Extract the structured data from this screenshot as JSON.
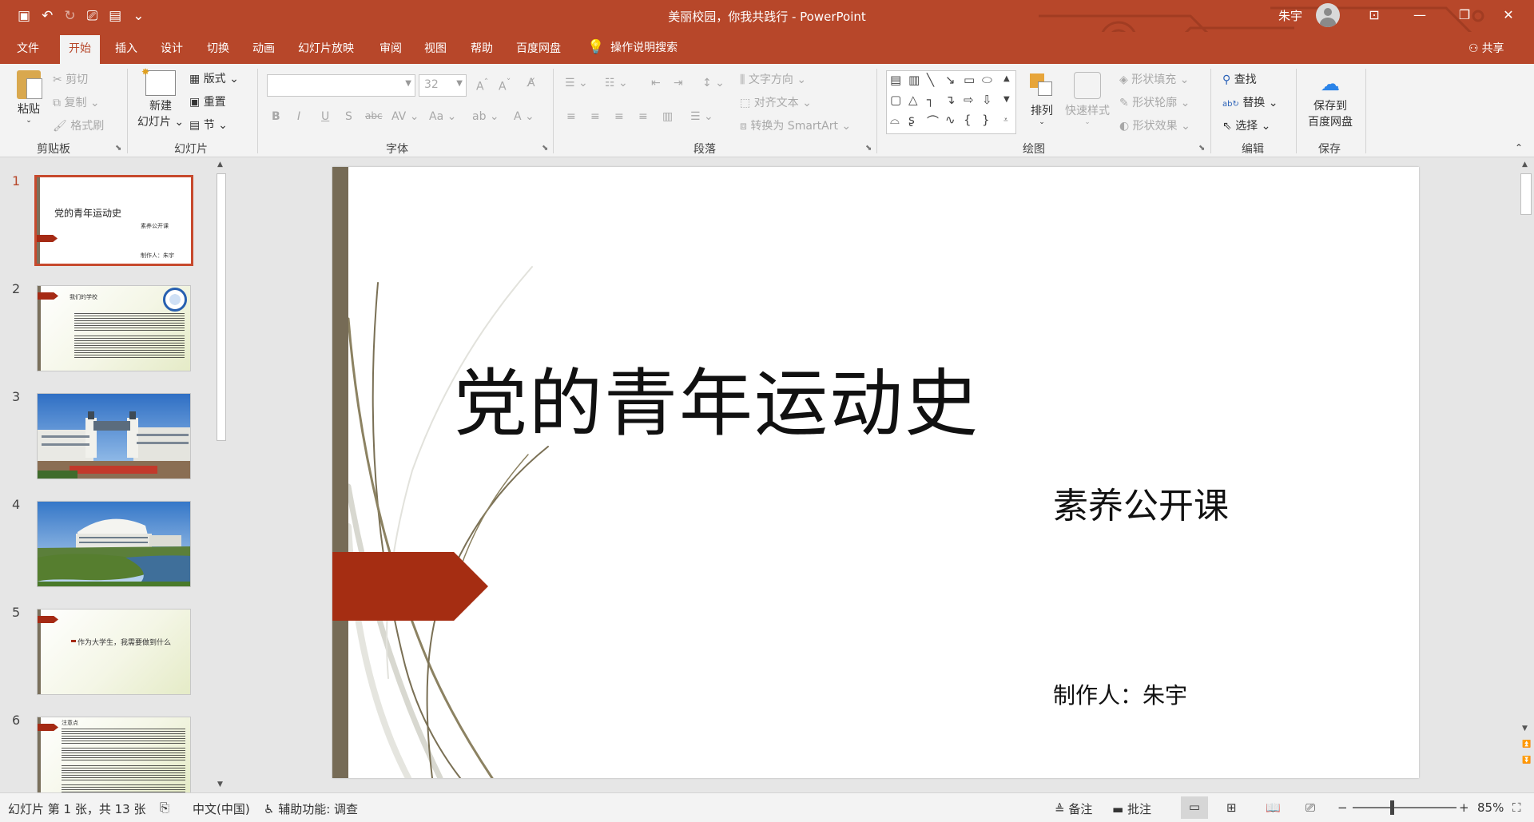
{
  "window": {
    "title": "美丽校园，你我共践行 - PowerPoint",
    "user": "朱宇",
    "colors": {
      "accent": "#b7472a",
      "slide_bar": "#766b56",
      "slide_flag": "#a52d12"
    }
  },
  "tabs": {
    "file": "文件",
    "home": "开始",
    "insert": "插入",
    "design": "设计",
    "transitions": "切换",
    "animations": "动画",
    "slideshow": "幻灯片放映",
    "review": "审阅",
    "view": "视图",
    "help": "帮助",
    "baidu": "百度网盘",
    "tell_me": "操作说明搜索",
    "share": "共享"
  },
  "ribbon": {
    "clipboard": {
      "paste": "粘贴",
      "cut": "剪切",
      "copy": "复制",
      "format_painter": "格式刷",
      "label": "剪贴板"
    },
    "slides": {
      "new_slide_1": "新建",
      "new_slide_2": "幻灯片",
      "layout": "版式",
      "reset": "重置",
      "section": "节",
      "label": "幻灯片"
    },
    "font": {
      "size": "32",
      "label": "字体"
    },
    "paragraph": {
      "text_direction": "文字方向",
      "align_text": "对齐文本",
      "smartart": "转换为 SmartArt",
      "label": "段落"
    },
    "drawing": {
      "arrange": "排列",
      "quick_styles": "快速样式",
      "shape_fill": "形状填充",
      "shape_outline": "形状轮廓",
      "shape_effects": "形状效果",
      "label": "绘图"
    },
    "editing": {
      "find": "查找",
      "replace": "替换",
      "select": "选择",
      "label": "编辑"
    },
    "save": {
      "save_to_1": "保存到",
      "save_to_2": "百度网盘",
      "label": "保存"
    }
  },
  "thumbnails": [
    {
      "num": "1",
      "title": "党的青年运动史",
      "sub": "素养公开课",
      "author": "制作人：朱宇"
    },
    {
      "num": "2",
      "title": "我们的学校"
    },
    {
      "num": "3"
    },
    {
      "num": "4"
    },
    {
      "num": "5",
      "title": "作为大学生，我需要做到什么"
    },
    {
      "num": "6",
      "title": "注意点"
    }
  ],
  "slide": {
    "title": "党的青年运动史",
    "subtitle": "素养公开课",
    "author": "制作人：朱宇"
  },
  "status": {
    "slide_info": "幻灯片 第 1 张，共 13 张",
    "language": "中文(中国)",
    "accessibility": "辅助功能: 调查",
    "notes": "备注",
    "comments": "批注",
    "zoom": "85%",
    "zoom_level": 0.85
  }
}
